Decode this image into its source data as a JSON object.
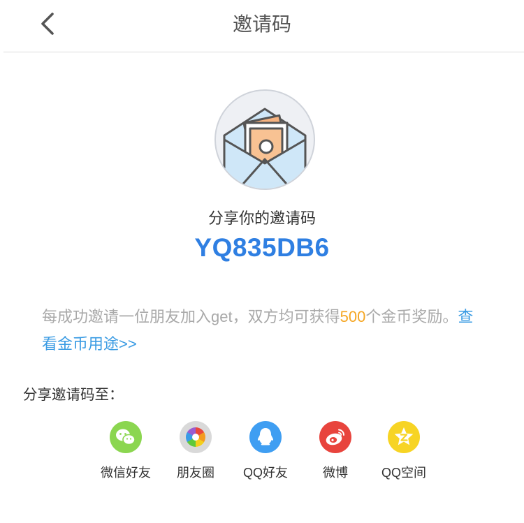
{
  "header": {
    "title": "邀请码",
    "back_icon": "chevron-left-icon"
  },
  "invite": {
    "illustration_icon": "envelope-money-icon",
    "subtitle": "分享你的邀请码",
    "code": "YQ835DB6"
  },
  "description": {
    "text_before": "每成功邀请一位朋友加入get，双方均可获得",
    "highlight": "500",
    "text_after": "个金币奖励。",
    "link": "查看金币用途>>"
  },
  "share": {
    "heading": "分享邀请码至：",
    "targets": [
      {
        "label": "微信好友",
        "icon": "wechat-icon",
        "color": "#8bd650"
      },
      {
        "label": "朋友圈",
        "icon": "moments-icon",
        "color": "#d9d9d9"
      },
      {
        "label": "QQ好友",
        "icon": "qq-icon",
        "color": "#3f9ef2"
      },
      {
        "label": "微博",
        "icon": "weibo-icon",
        "color": "#e8443d"
      },
      {
        "label": "QQ空间",
        "icon": "qzone-icon",
        "color": "#f7d424"
      }
    ]
  },
  "colors": {
    "code": "#2f7fe2",
    "highlight": "#f5a623",
    "link": "#3a9be3",
    "description": "#a9a9a9"
  }
}
